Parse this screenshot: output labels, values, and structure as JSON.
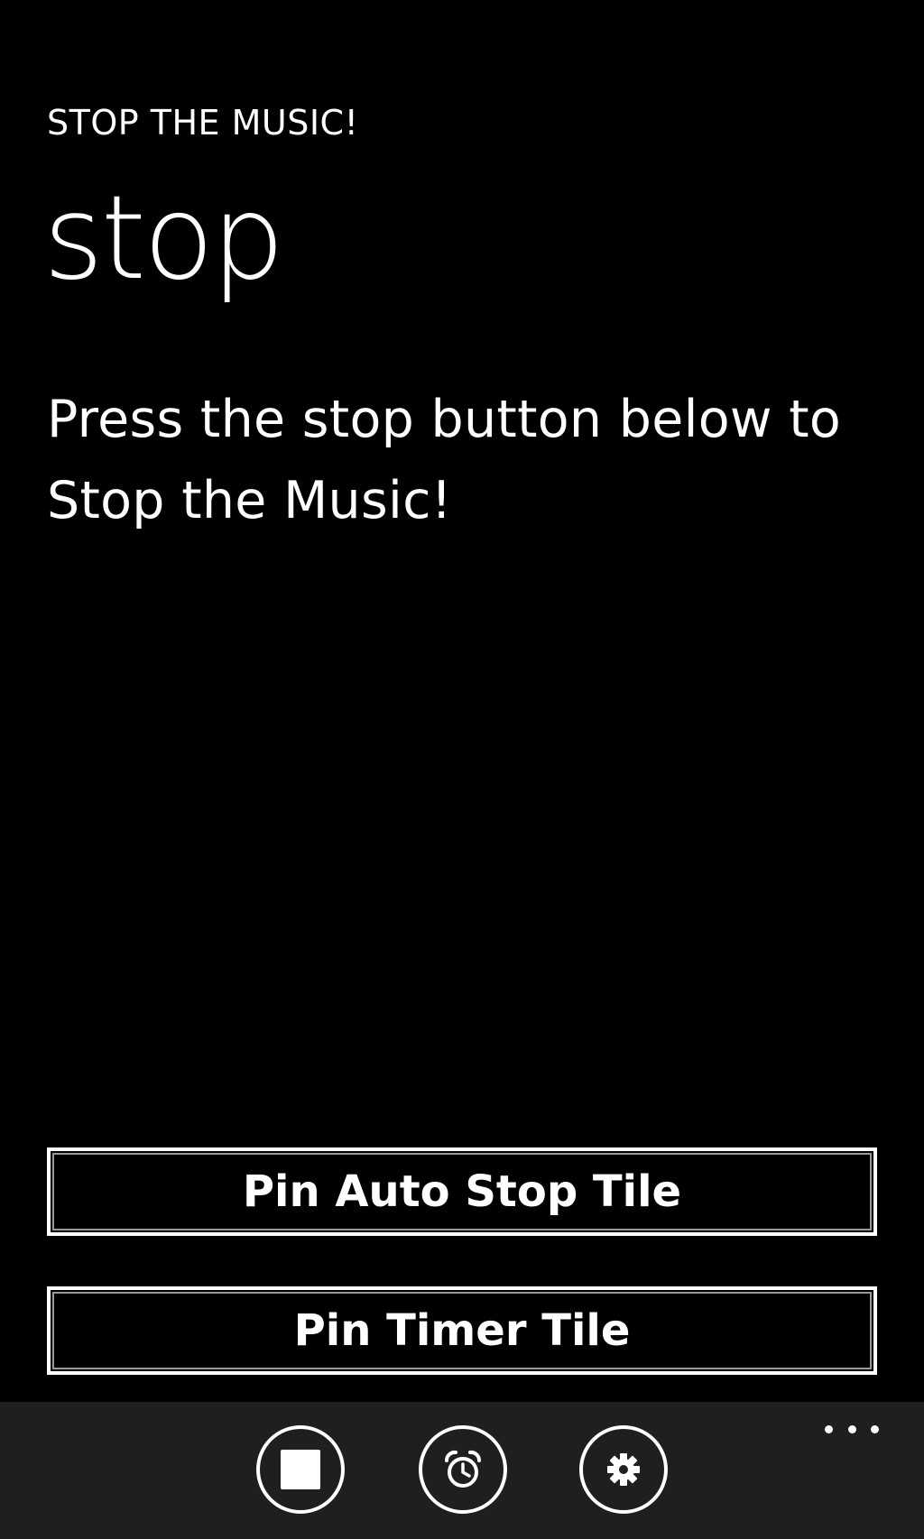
{
  "app": {
    "title": "STOP THE MUSIC!"
  },
  "page": {
    "title": "stop",
    "instructions": "Press the stop button below to Stop the Music!"
  },
  "buttons": {
    "pin_auto_stop": "Pin Auto Stop Tile",
    "pin_timer": "Pin Timer Tile"
  },
  "app_bar": {
    "icons": [
      "stop-icon",
      "alarm-clock-icon",
      "gear-icon",
      "more-icon"
    ],
    "colors": {
      "background": "#1f1f1f",
      "foreground": "#ffffff"
    }
  },
  "colors": {
    "page_background": "#000000",
    "text": "#ffffff"
  }
}
